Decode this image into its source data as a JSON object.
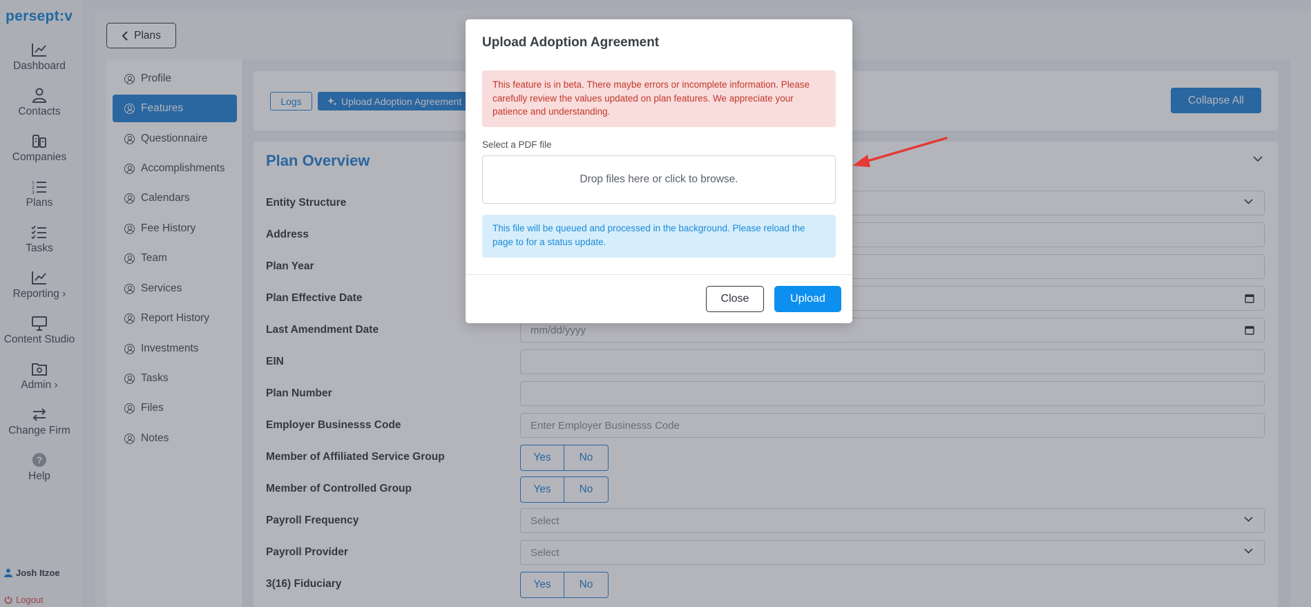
{
  "app": {
    "logo": "persept:v"
  },
  "nav": {
    "items": [
      {
        "label": "Dashboard",
        "icon": "chart-line-icon"
      },
      {
        "label": "Contacts",
        "icon": "person-icon"
      },
      {
        "label": "Companies",
        "icon": "building-icon"
      },
      {
        "label": "Plans",
        "icon": "numbered-list-icon"
      },
      {
        "label": "Tasks",
        "icon": "checklist-icon"
      },
      {
        "label": "Reporting",
        "icon": "chart-line-icon",
        "chevron": "›"
      },
      {
        "label": "Content Studio",
        "icon": "presentation-icon"
      },
      {
        "label": "Admin",
        "icon": "folder-gear-icon",
        "chevron": "›"
      },
      {
        "label": "Change Firm",
        "icon": "swap-arrows-icon"
      },
      {
        "label": "Help",
        "icon": "question-icon"
      }
    ],
    "user": "Josh Itzoe",
    "logout": "Logout"
  },
  "header": {
    "back_label": "Plans"
  },
  "subnav": {
    "items": [
      "Profile",
      "Features",
      "Questionnaire",
      "Accomplishments",
      "Calendars",
      "Fee History",
      "Team",
      "Services",
      "Report History",
      "Investments",
      "Tasks",
      "Files",
      "Notes"
    ],
    "active": "Features"
  },
  "toolbar": {
    "logs_label": "Logs",
    "upload_agreement_label": "Upload Adoption Agreement",
    "collapse_label": "Collapse All"
  },
  "overview": {
    "title": "Plan Overview",
    "fields": [
      {
        "label": "Entity Structure",
        "type": "select",
        "value": ""
      },
      {
        "label": "Address",
        "type": "textarea",
        "value": ""
      },
      {
        "label": "Plan Year",
        "type": "text",
        "value": ""
      },
      {
        "label": "Plan Effective Date",
        "type": "date",
        "value": ""
      },
      {
        "label": "Last Amendment Date",
        "type": "date",
        "value": "mm/dd/yyyy"
      },
      {
        "label": "EIN",
        "type": "text",
        "value": ""
      },
      {
        "label": "Plan Number",
        "type": "text",
        "value": ""
      },
      {
        "label": "Employer Businesss Code",
        "type": "text",
        "placeholder": "Enter Employer Businesss Code"
      },
      {
        "label": "Member of Affiliated Service Group",
        "type": "yesno"
      },
      {
        "label": "Member of Controlled Group",
        "type": "yesno"
      },
      {
        "label": "Payroll Frequency",
        "type": "select",
        "value": "Select"
      },
      {
        "label": "Payroll Provider",
        "type": "select",
        "value": "Select"
      },
      {
        "label": "3(16) Fiduciary",
        "type": "yesno"
      }
    ],
    "yes_label": "Yes",
    "no_label": "No"
  },
  "modal": {
    "title": "Upload Adoption Agreement",
    "beta_warning": "This feature is in beta. There maybe errors or incomplete information. Please carefully review the values updated on plan features. We appreciate your patience and understanding.",
    "file_label": "Select a PDF file",
    "dropzone_text": "Drop files here or click to browse.",
    "info": "This file will be queued and processed in the background. Please reload the page to for a status update.",
    "close_label": "Close",
    "upload_label": "Upload"
  },
  "colors": {
    "primary": "#2c86d4",
    "upload_button": "#0d8ff0",
    "danger_bg": "#f9dcdc",
    "danger_text": "#c0392b",
    "info_bg": "#d6edfb",
    "info_text": "#1b8bd6",
    "arrow": "#e53935"
  }
}
